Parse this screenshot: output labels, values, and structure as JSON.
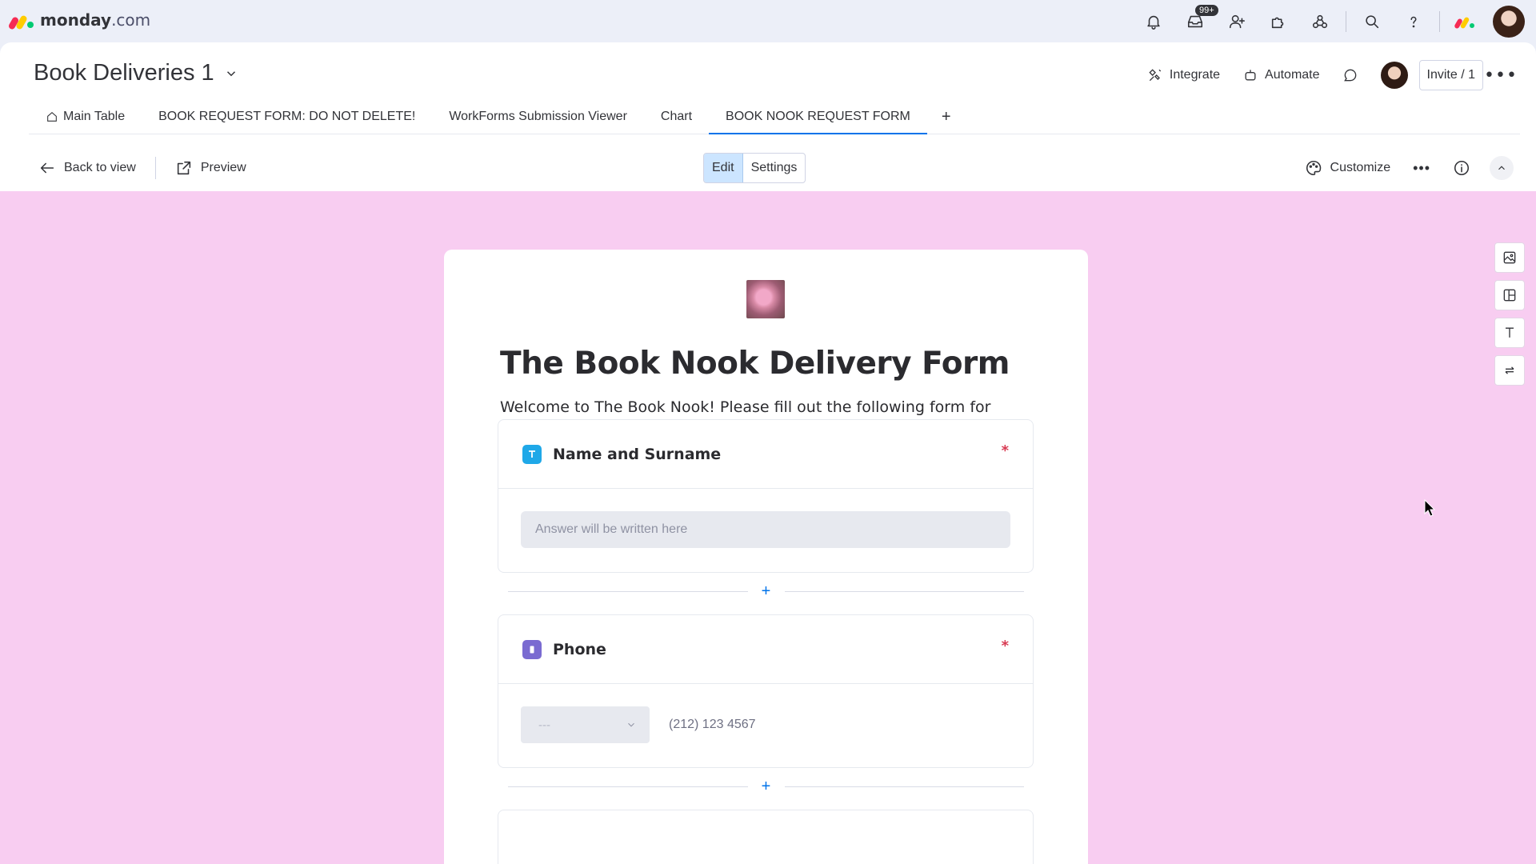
{
  "app": {
    "logo_word": "monday",
    "logo_suffix": ".com",
    "inbox_badge": "99+"
  },
  "top_icons": [
    "bell-icon",
    "inbox-icon",
    "invite-members-icon",
    "apps-icon",
    "integrations-icon",
    "search-icon",
    "help-icon"
  ],
  "board": {
    "title": "Book Deliveries 1",
    "integrate_label": "Integrate",
    "automate_label": "Automate",
    "invite_label": "Invite / 1"
  },
  "tabs": [
    {
      "label": "Main Table"
    },
    {
      "label": "BOOK REQUEST FORM: DO NOT DELETE!"
    },
    {
      "label": "WorkForms Submission Viewer"
    },
    {
      "label": "Chart"
    },
    {
      "label": "BOOK NOOK REQUEST FORM"
    },
    {
      "label": "+"
    }
  ],
  "toolbar": {
    "back_label": "Back to view",
    "preview_label": "Preview",
    "edit_label": "Edit",
    "settings_label": "Settings",
    "customize_label": "Customize",
    "active_mode": "Edit"
  },
  "form": {
    "title": "The Book Nook Delivery Form",
    "description": "Welcome to The Book Nook! Please fill out the following form for all delivery requests.",
    "background_color": "#f8cdf1",
    "questions": [
      {
        "title": "Name and Surname",
        "required_mark": "*",
        "placeholder": "Answer will be written here",
        "icon_color": "#1fa8e8"
      },
      {
        "title": "Phone",
        "required_mark": "*",
        "country_placeholder": "---",
        "phone_placeholder": "(212) 123 4567",
        "icon_color": "#7a6bd1"
      }
    ],
    "add_question_label": "+"
  },
  "colors": {
    "accent": "#0073ea",
    "required": "#d83a52",
    "edit_active_bg": "#cce5ff"
  }
}
